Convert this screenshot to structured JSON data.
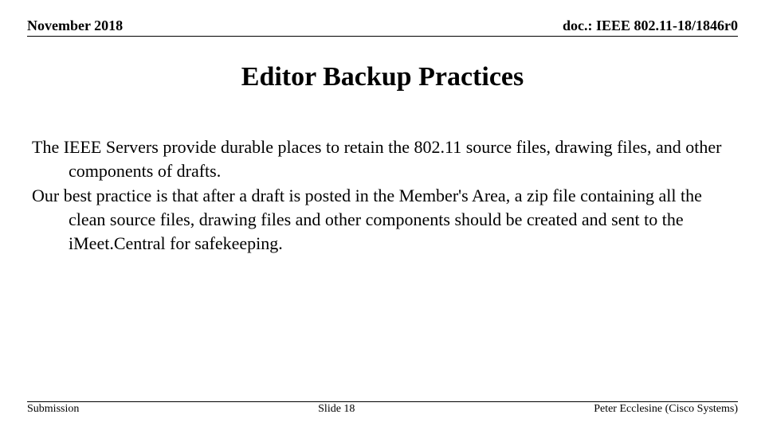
{
  "header": {
    "date": "November 2018",
    "doc_id": "doc.: IEEE 802.11-18/1846r0"
  },
  "title": "Editor Backup Practices",
  "body": {
    "p1": "The IEEE Servers provide durable places to retain the 802.11 source files, drawing files, and other components of drafts.",
    "p2": "Our best practice is that after a draft is posted in the Member's Area, a zip file containing all the clean source files, drawing files and other components should be created and sent to the iMeet.Central for safekeeping."
  },
  "footer": {
    "left": "Submission",
    "center": "Slide 18",
    "right": "Peter Ecclesine (Cisco Systems)"
  }
}
